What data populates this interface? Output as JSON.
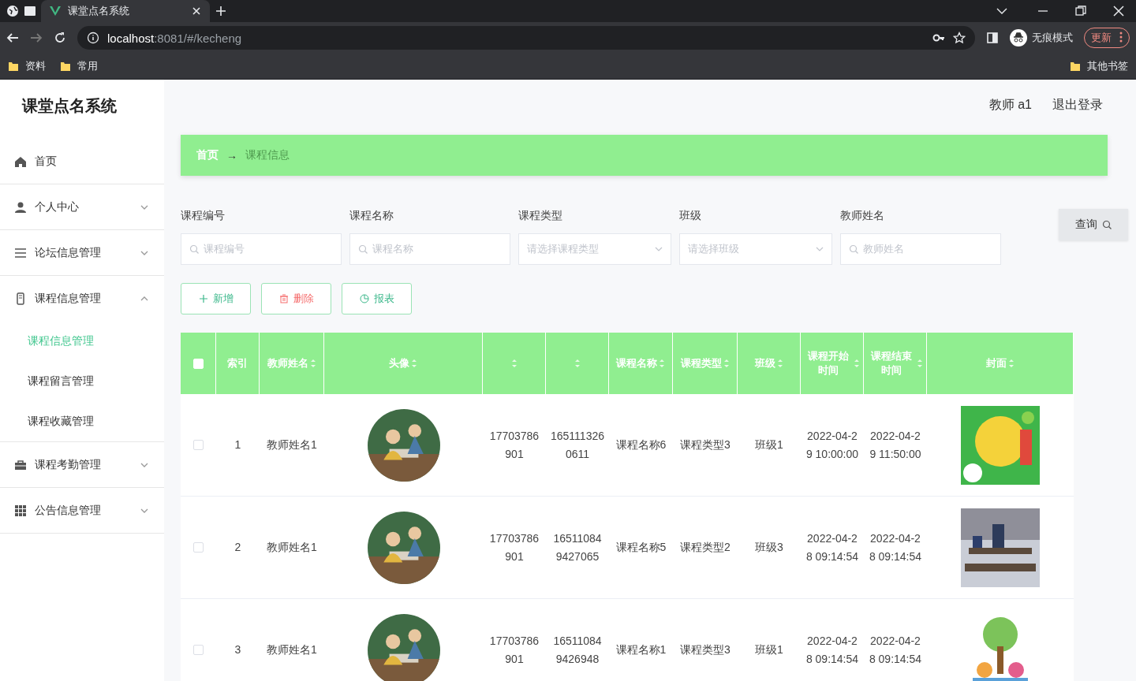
{
  "browser": {
    "tabs": [
      {
        "title": "课堂点名系统",
        "selected": true
      }
    ],
    "url_host": "localhost",
    "url_rest": ":8081/#/kecheng",
    "profile": "无痕模式",
    "update": "更新",
    "bookmarks": [
      "资料",
      "常用"
    ],
    "other_bookmarks": "其他书签"
  },
  "app": {
    "title": "课堂点名系统",
    "user": "教师 a1",
    "logout": "退出登录"
  },
  "sidebar": {
    "items": [
      {
        "label": "首页"
      },
      {
        "label": "个人中心",
        "expanded": false
      },
      {
        "label": "论坛信息管理",
        "expanded": false
      },
      {
        "label": "课程信息管理",
        "expanded": true,
        "children": [
          {
            "label": "课程信息管理",
            "selected": true
          },
          {
            "label": "课程留言管理",
            "selected": false
          },
          {
            "label": "课程收藏管理",
            "selected": false
          }
        ]
      },
      {
        "label": "课程考勤管理",
        "expanded": false
      },
      {
        "label": "公告信息管理",
        "expanded": false
      }
    ]
  },
  "breadcrumb": {
    "items": [
      "首页",
      "课程信息"
    ],
    "separator": "→"
  },
  "filters": [
    {
      "label": "课程编号",
      "placeholder": "课程编号",
      "kind": "search"
    },
    {
      "label": "课程名称",
      "placeholder": "课程名称",
      "kind": "search"
    },
    {
      "label": "课程类型",
      "placeholder": "请选择课程类型",
      "kind": "select"
    },
    {
      "label": "班级",
      "placeholder": "请选择班级",
      "kind": "select"
    },
    {
      "label": "教师姓名",
      "placeholder": "教师姓名",
      "kind": "search"
    }
  ],
  "query_button": "查询",
  "actions": [
    {
      "label": "新增",
      "kind": "add"
    },
    {
      "label": "删除",
      "kind": "delete"
    },
    {
      "label": "报表",
      "kind": "report"
    }
  ],
  "table": {
    "select_all_checked": false,
    "columns": [
      {
        "label": "索引",
        "kind": "text"
      },
      {
        "label": "教师姓名",
        "kind": "text",
        "sortable": true
      },
      {
        "label": "头像",
        "kind": "avatar",
        "sortable": true
      },
      {
        "kind": "text",
        "sortable": true
      },
      {
        "kind": "text",
        "sortable": true
      },
      {
        "label": "课程名称",
        "kind": "text",
        "sortable": true
      },
      {
        "label": "课程类型",
        "kind": "text",
        "sortable": true
      },
      {
        "label": "班级",
        "kind": "text",
        "sortable": true
      },
      {
        "label": "课程开始时间",
        "kind": "text",
        "sortable": true
      },
      {
        "label": "课程结束时间",
        "kind": "text",
        "sortable": true
      },
      {
        "label": "封面",
        "kind": "cover",
        "sortable": true
      }
    ],
    "rows": [
      {
        "checked": false,
        "cells": [
          "1",
          "教师姓名1",
          "",
          "17703786901",
          "1651113260611",
          "课程名称6",
          "课程类型3",
          "班级1",
          "2022-04-29 10:00:00",
          "2022-04-29 11:50:00",
          ""
        ]
      },
      {
        "checked": false,
        "cells": [
          "2",
          "教师姓名1",
          "",
          "17703786901",
          "165110849427065",
          "课程名称5",
          "课程类型2",
          "班级3",
          "2022-04-28 09:14:54",
          "2022-04-28 09:14:54",
          ""
        ]
      },
      {
        "checked": false,
        "cells": [
          "3",
          "教师姓名1",
          "",
          "17703786901",
          "165110849426948",
          "课程名称1",
          "课程类型3",
          "班级1",
          "2022-04-28 09:14:54",
          "2022-04-28 09:14:54",
          ""
        ]
      }
    ]
  }
}
